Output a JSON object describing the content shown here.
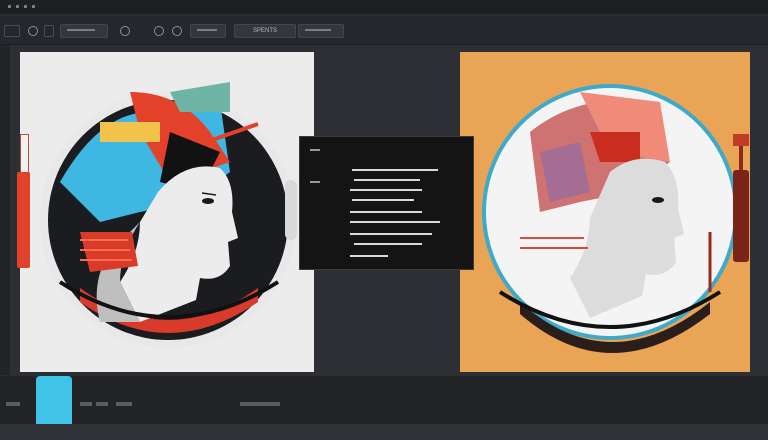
{
  "toolbar": {
    "path_field": "SPENTS",
    "tools": [
      "hand-tool",
      "marquee-tool",
      "lasso-tool",
      "crop-tool",
      "brush-tool",
      "eyedropper-tool",
      "history-tool"
    ]
  },
  "colors": {
    "left_canvas": "#ececec",
    "right_canvas": "#eaa456",
    "panel": "#141414",
    "accent_red": "#e0422b",
    "accent_cyan": "#3fc3e6"
  },
  "layers_panel": {
    "entries": [
      "layer-1",
      "layer-2",
      "layer-3",
      "layer-4",
      "layer-5",
      "layer-6",
      "layer-7"
    ]
  }
}
